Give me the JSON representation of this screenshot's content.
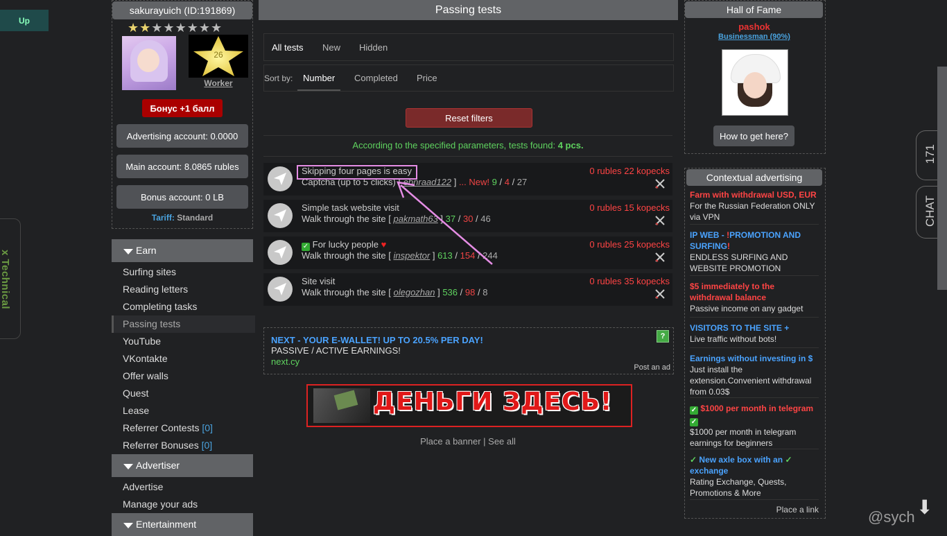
{
  "floating": {
    "up_label": "Up",
    "technical_label": "x Technical",
    "chat_count": "171",
    "chat_label": "CHAT"
  },
  "user": {
    "name": "sakurayuich (ID:191869)",
    "stars_filled": 2,
    "stars_total": 8,
    "level": "26",
    "level_name": "Worker",
    "bonus_button": "Бонус +1 балл",
    "advertising_account": "Advertising account: 0.0000",
    "main_account": "Main account: 8.0865 rubles",
    "bonus_account": "Bonus account: 0 LB",
    "tariff_label": "Tariff:",
    "tariff_value": "Standard"
  },
  "menu": {
    "earn": {
      "title": "Earn",
      "items": [
        {
          "label": "Surfing sites"
        },
        {
          "label": "Reading letters"
        },
        {
          "label": "Completing tasks"
        },
        {
          "label": "Passing tests"
        },
        {
          "label": "YouTube"
        },
        {
          "label": "VKontakte"
        },
        {
          "label": "Offer walls"
        },
        {
          "label": "Quest"
        },
        {
          "label": "Lease"
        },
        {
          "label": "Referrer Contests",
          "count": "[0]"
        },
        {
          "label": "Referrer Bonuses",
          "count": "[0]"
        }
      ]
    },
    "advertiser": {
      "title": "Advertiser",
      "items": [
        {
          "label": "Advertise"
        },
        {
          "label": "Manage your ads"
        }
      ]
    },
    "entertainment": {
      "title": "Entertainment"
    }
  },
  "center": {
    "title": "Passing tests",
    "tabs": [
      "All tests",
      "New",
      "Hidden"
    ],
    "sort_label": "Sort by:",
    "sort_options": [
      "Number",
      "Completed",
      "Price"
    ],
    "reset_button": "Reset filters",
    "found_text": "According to the specified parameters, tests found: ",
    "found_count": "4 pcs.",
    "tests": [
      {
        "title": "Skipping four pages is easy",
        "subtitle": "Captcha (up to 5 clicks)",
        "author": "ebnraad122",
        "new_label": "... New!",
        "passed": "9",
        "failed": "4",
        "total": "27",
        "price": "0 rubles 22 kopecks"
      },
      {
        "title": "Simple task website visit",
        "subtitle": "Walk through the site",
        "author": "pakmath63",
        "passed": "37",
        "failed": "30",
        "total": "46",
        "price": "0 rubles 15 kopecks"
      },
      {
        "title": "For lucky people",
        "subtitle": "Walk through the site",
        "author": "inspektor",
        "passed": "613",
        "failed": "154",
        "total": "244",
        "price": "0 rubles 25 kopecks"
      },
      {
        "title": "Site visit",
        "subtitle": "Walk through the site",
        "author": "olegozhan",
        "passed": "536",
        "failed": "98",
        "total": "8",
        "price": "0 rubles 35 kopecks"
      }
    ],
    "ad": {
      "title": "NEXT - YOUR E-WALLET! UP TO 20.5% PER DAY!",
      "text": "PASSIVE / ACTIVE EARNINGS!",
      "link": "next.cy",
      "help": "?",
      "post_ad": "Post an ad"
    },
    "banner_text": "ДЕНЬГИ ЗДЕСЬ!",
    "banner_place": "Place a banner",
    "banner_sep": " | ",
    "banner_see_all": "See all"
  },
  "right": {
    "hof_title": "Hall of Fame",
    "hof_name": "pashok",
    "hof_rank": "Businessman (90%)",
    "hof_button": "How to get here?",
    "ctx_title": "Contextual advertising",
    "ctx_items": [
      {
        "head": "Farm with withdrawal USD, EUR",
        "desc": "For the Russian Federation ONLY via VPN"
      },
      {
        "head_a": "IP WEB - ",
        "head_b": "!",
        "head_c": "PROMOTION AND SURFING",
        "head_d": "!",
        "desc": "ENDLESS SURFING AND WEBSITE PROMOTION"
      },
      {
        "head": "$5 immediately to the withdrawal balance",
        "desc": "Passive income on any gadget"
      },
      {
        "head": "VISITORS TO THE SITE +",
        "desc": "Live traffic without bots!"
      },
      {
        "head": "Earnings without investing in $",
        "desc": "Just install the extension.Convenient withdrawal from 0.03$"
      },
      {
        "head": "$1000 per month in telegram",
        "desc": "$1000 per month in telegram earnings for beginners"
      },
      {
        "head": "New axle box with an",
        "head2": "exchange",
        "desc": "Rating Exchange, Quests, Promotions & More"
      }
    ],
    "place_link": "Place a link"
  },
  "watermark": "@sych",
  "colors": {
    "background": "#202123",
    "panel_header": "#616366",
    "accent_red": "#ff4444",
    "accent_green": "#5fd35f",
    "accent_blue": "#4aa3ff",
    "highlight_pink": "#e58de5"
  }
}
